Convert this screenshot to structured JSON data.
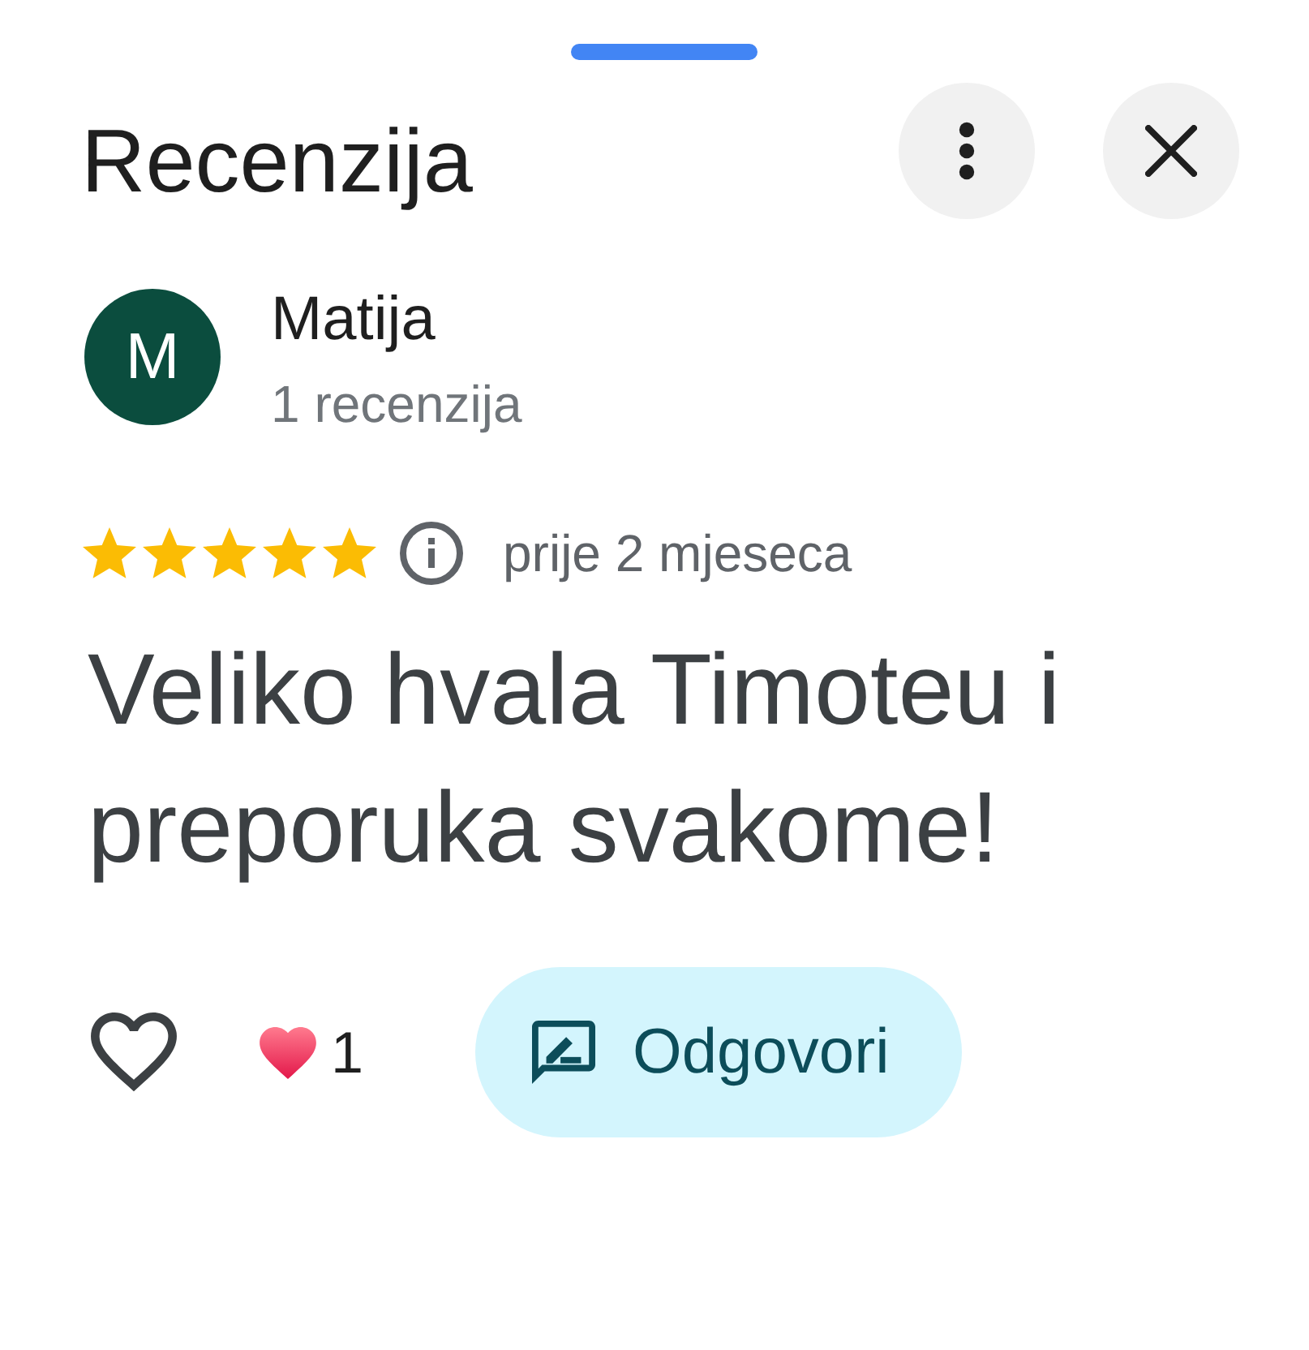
{
  "sheet": {
    "title": "Recenzija"
  },
  "author": {
    "initial": "M",
    "name": "Matija",
    "review_count": "1 recenzija"
  },
  "review": {
    "stars": 5,
    "time": "prije 2 mjeseca",
    "text": "Veliko hvala Timoteu i preporuka svakome!"
  },
  "actions": {
    "liked": false,
    "reaction_count": "1",
    "reply_label": "Odgovori"
  }
}
